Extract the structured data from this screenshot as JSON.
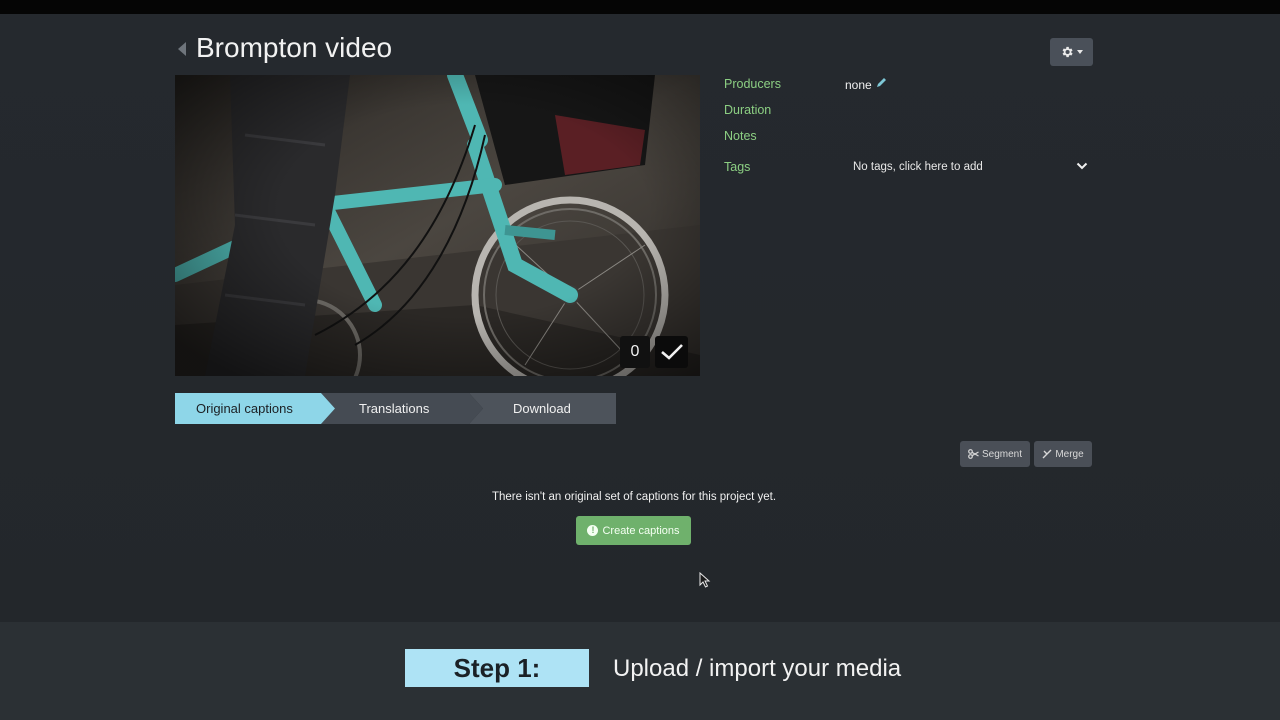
{
  "page": {
    "title": "Brompton video"
  },
  "video": {
    "counter": "0"
  },
  "metadata": {
    "producers_label": "Producers",
    "producers_value": "none",
    "duration_label": "Duration",
    "notes_label": "Notes",
    "tags_label": "Tags",
    "tags_value": "No tags, click here to add"
  },
  "tabs": [
    {
      "label": "Original captions",
      "active": true
    },
    {
      "label": "Translations",
      "active": false
    },
    {
      "label": "Download",
      "active": false
    }
  ],
  "toolbar": {
    "segment_label": "Segment",
    "merge_label": "Merge"
  },
  "captions": {
    "empty_message": "There isn't an original set of captions for this project yet.",
    "create_label": "Create captions"
  },
  "footer": {
    "step_label": "Step 1:",
    "step_text": "Upload / import your media"
  },
  "colors": {
    "accent_label": "#8ccf83",
    "active_tab": "#8ed6e8",
    "create_button": "#6fb16c",
    "step_badge": "#aee3f5"
  },
  "icons": {
    "settings": "gear-icon",
    "back": "back-arrow-icon",
    "edit": "pencil-icon",
    "tags_toggle": "chevron-down-icon",
    "approve": "check-icon",
    "segment": "scissors-icon",
    "merge": "merge-icon",
    "create": "info-icon"
  }
}
